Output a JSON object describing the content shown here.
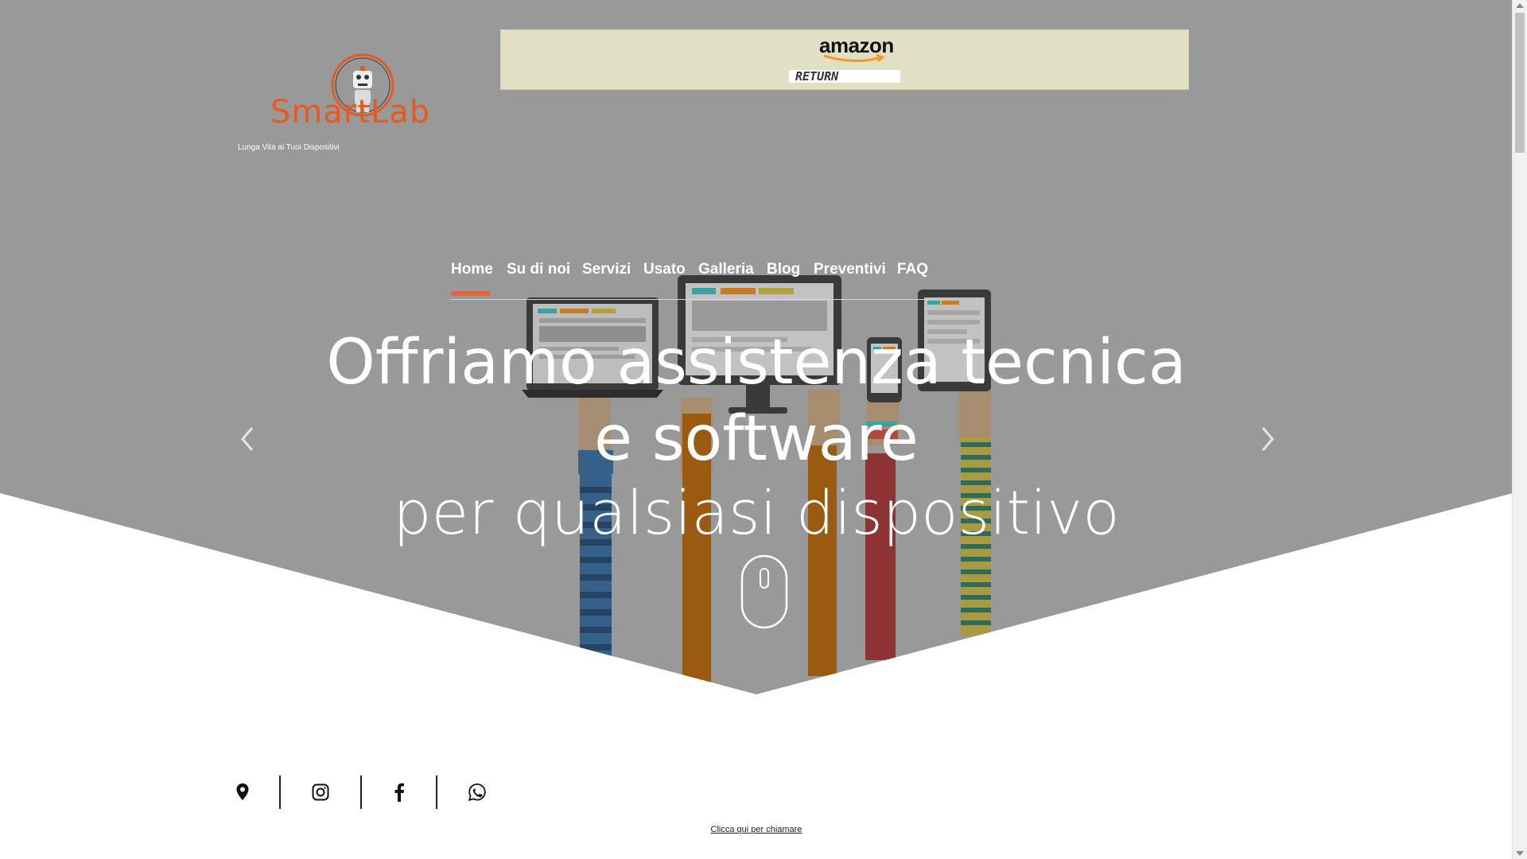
{
  "brand": {
    "name": "SmartLab",
    "tagline": "Lunga Vita ai Tuoi Dispositivi",
    "color": "#e65a1e"
  },
  "ad_banner": {
    "logo_text": "amazon",
    "return_label": "RETURN"
  },
  "nav": {
    "items": [
      {
        "label": "Home",
        "active": true
      },
      {
        "label": "Su di noi"
      },
      {
        "label": "Servizi"
      },
      {
        "label": "Usato"
      },
      {
        "label": "Galleria"
      },
      {
        "label": "Blog"
      },
      {
        "label": "Preventivi"
      },
      {
        "label": "FAQ"
      }
    ],
    "active_color": "#e0643c"
  },
  "hero": {
    "title": "Offriamo assistenza tecnica e software",
    "subtitle": "per qualsiasi dispositivo",
    "background_color": "#999999",
    "prev_icon": "chevron-left-icon",
    "next_icon": "chevron-right-icon",
    "scroll_icon": "mouse-scroll-icon"
  },
  "social": {
    "icons": [
      "map-pin-icon",
      "instagram-icon",
      "facebook-icon",
      "whatsapp-icon"
    ]
  },
  "call_link": "Clicca qui per chiamare"
}
